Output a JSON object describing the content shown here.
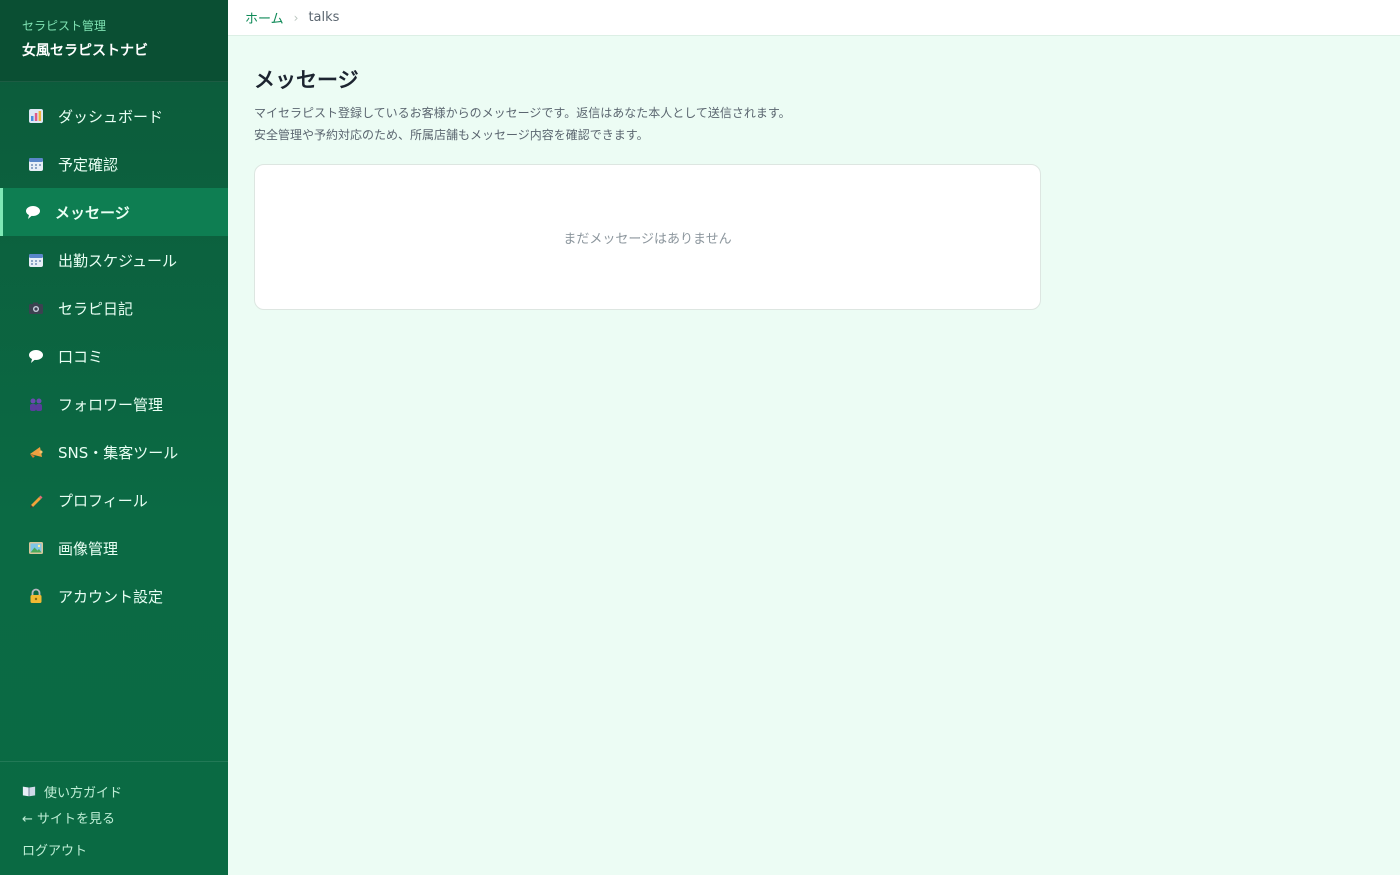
{
  "brand": {
    "subtitle": "セラピスト管理",
    "title": "女風セラピストナビ"
  },
  "nav": [
    {
      "label": "ダッシュボード",
      "icon": "bar-chart-icon",
      "active": false
    },
    {
      "label": "予定確認",
      "icon": "calendar-icon",
      "active": false
    },
    {
      "label": "メッセージ",
      "icon": "speech-bubble-icon",
      "active": true
    },
    {
      "label": "出勤スケジュール",
      "icon": "calendar-icon",
      "active": false
    },
    {
      "label": "セラピ日記",
      "icon": "camera-icon",
      "active": false
    },
    {
      "label": "口コミ",
      "icon": "speech-bubble-icon",
      "active": false
    },
    {
      "label": "フォロワー管理",
      "icon": "people-icon",
      "active": false
    },
    {
      "label": "SNS・集客ツール",
      "icon": "megaphone-icon",
      "active": false
    },
    {
      "label": "プロフィール",
      "icon": "pencil-icon",
      "active": false
    },
    {
      "label": "画像管理",
      "icon": "picture-icon",
      "active": false
    },
    {
      "label": "アカウント設定",
      "icon": "lock-icon",
      "active": false
    }
  ],
  "footer": {
    "guide": "使い方ガイド",
    "site": "← サイトを見る",
    "logout": "ログアウト"
  },
  "breadcrumb": {
    "home": "ホーム",
    "separator": "›",
    "current": "talks"
  },
  "page": {
    "title": "メッセージ",
    "desc_line1": "マイセラピスト登録しているお客様からのメッセージです。返信はあなた本人として送信されます。",
    "desc_line2": "安全管理や予約対応のため、所属店舗もメッセージ内容を確認できます。",
    "empty": "まだメッセージはありません"
  },
  "colors": {
    "sidebar": "#0b6a44",
    "accent": "#0f8a58",
    "background": "#ecfcf4"
  }
}
